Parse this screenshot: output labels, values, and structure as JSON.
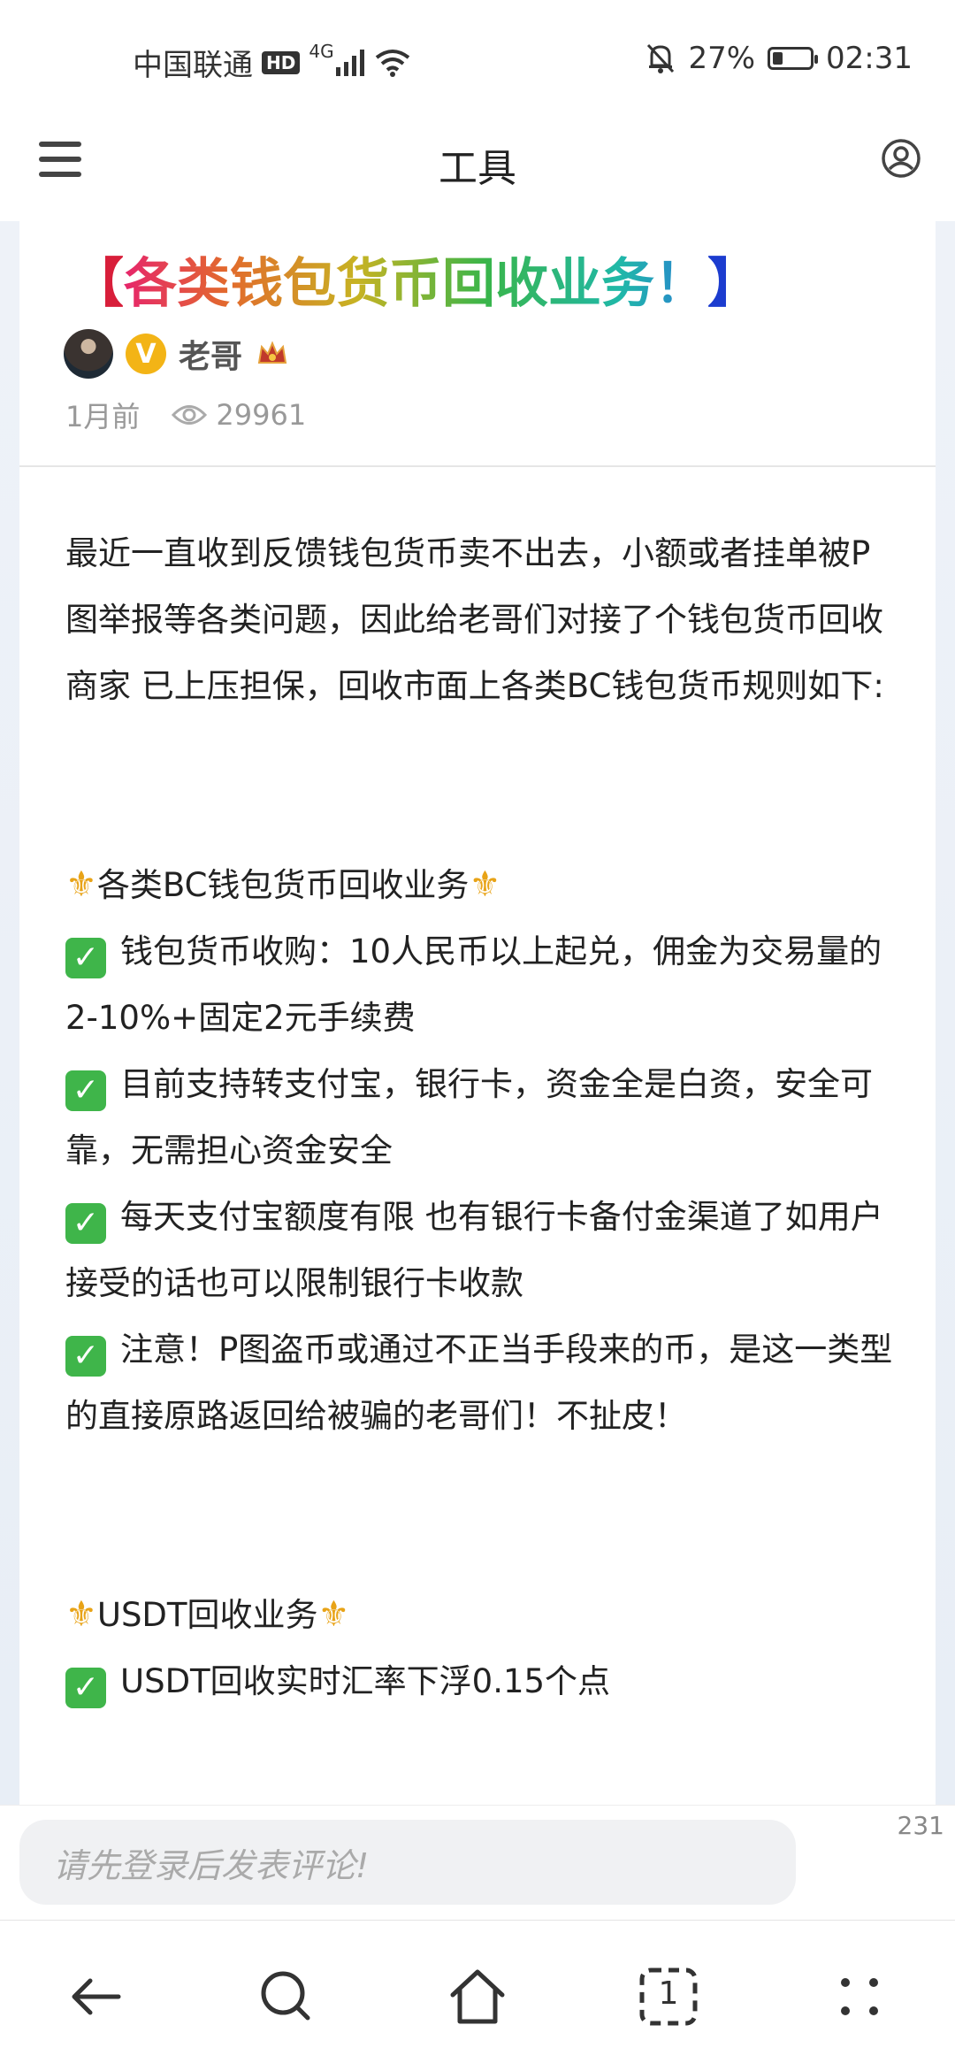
{
  "status_bar": {
    "carrier": "中国联通",
    "hd": "HD",
    "network": "4G",
    "battery": "27%",
    "battery_level": 0.27,
    "time": "02:31"
  },
  "header": {
    "title": "工具",
    "menu_icon": "menu-icon",
    "user_icon": "user-icon"
  },
  "post": {
    "title_open": "【",
    "title_text": "各类钱包货币回收业务！",
    "title_close": "】",
    "author": "老哥",
    "verified_badge": "V",
    "time_ago": "1月前",
    "views": "29961",
    "intro": "最近一直收到反馈钱包货币卖不出去，小额或者挂单被P图举报等各类问题，因此给老哥们对接了个钱包货币回收商家 已上压担保，回收市面上各类BC钱包货币规则如下:",
    "section1": {
      "heading": "各类BC钱包货币回收业务",
      "items": [
        "钱包货币收购：10人民币以上起兑，佣金为交易量的2-10%+固定2元手续费",
        "目前支持转支付宝，银行卡，资金全是白资，安全可靠，无需担心资金安全",
        "每天支付宝额度有限  也有银行卡备付金渠道了如用户接受的话也可以限制银行卡收款",
        "注意！P图盗币或通过不正当手段来的币，是这一类型的直接原路返回给被骗的老哥们！不扯皮！"
      ]
    },
    "section2": {
      "heading": "USDT回收业务",
      "items": [
        "USDT回收实时汇率下浮0.15个点"
      ]
    }
  },
  "comment": {
    "placeholder": "请先登录后发表评论!",
    "count": "231"
  },
  "nav": {
    "tab_count": "1"
  },
  "colors": {
    "check_green": "#3fb54a",
    "fleur_gold": "#e8a317",
    "badge_gold": "#f3b416"
  }
}
